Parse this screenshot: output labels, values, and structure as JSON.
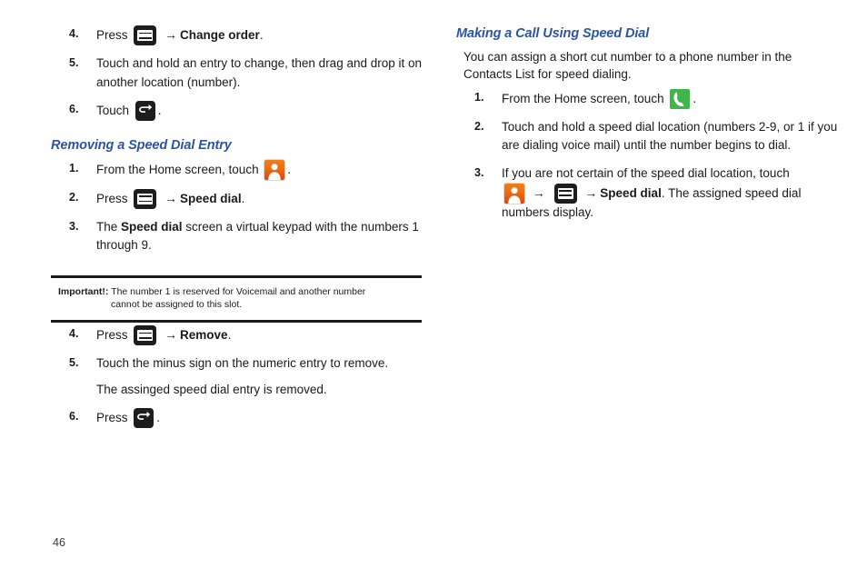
{
  "page": {
    "number": "46"
  },
  "icons": {
    "menu": "menu-key-icon",
    "back": "back-key-icon",
    "contacts": "contacts-app-icon",
    "phone": "phone-app-icon",
    "arrow": "→"
  },
  "left_column": {
    "continued_steps": [
      {
        "num": "4.",
        "parts": [
          "Press ",
          "[menu-icon]",
          " → ",
          "Change order",
          "."
        ],
        "lead": "Press",
        "icon": "menu",
        "bold_text": "Change order",
        "trailing": "."
      },
      {
        "num": "5.",
        "text": "Touch and hold an entry to change, then drag and drop it on another location (number)."
      },
      {
        "num": "6.",
        "lead": "Touch",
        "icon": "back",
        "trailing": "."
      }
    ],
    "section": {
      "heading": "Removing a Speed Dial Entry",
      "steps": [
        {
          "num": "1.",
          "lead": "From the Home screen, touch",
          "icon": "contacts",
          "trailing": "."
        },
        {
          "num": "2.",
          "lead": "Press",
          "icon": "menu",
          "bold_text": "Speed dial",
          "trailing": "."
        },
        {
          "num": "3.",
          "pre": "The ",
          "bold_text": "Speed dial",
          "post": " screen a virtual keypad with the numbers 1 through 9."
        }
      ]
    },
    "note": {
      "label": "Important!:",
      "line1": "The number 1 is reserved for Voicemail and another number",
      "line2": "cannot be assigned to this slot."
    },
    "lower_steps": [
      {
        "num": "4.",
        "lead": "Press",
        "icon": "menu",
        "bold_text": "Remove",
        "trailing": "."
      },
      {
        "num": "5.",
        "text": "Touch the minus sign on the numeric entry to remove.",
        "sub": "The assinged speed dial entry is removed."
      },
      {
        "num": "6.",
        "lead": "Press",
        "icon": "back",
        "trailing": "."
      }
    ]
  },
  "right_column": {
    "heading": "Making a Call Using Speed Dial",
    "intro": "You can assign a short cut number to a phone number in the Contacts List for speed dialing.",
    "steps": [
      {
        "num": "1.",
        "lead": "From the Home screen, touch",
        "icon": "phone",
        "trailing": "."
      },
      {
        "num": "2.",
        "text": "Touch and hold a speed dial location (numbers 2-9, or 1 if you are dialing voice mail) until the number begins to dial."
      },
      {
        "num": "3.",
        "pre": "If you are not certain of the speed dial location, touch",
        "bold_text": "Speed dial",
        "post": ". The assigned speed dial numbers display."
      }
    ]
  },
  "colors": {
    "heading_blue": "#2b53a8",
    "body_text": "#1a1a1a",
    "icon_dark": "#1d1d1d",
    "icon_orange": "#ee6b12",
    "icon_green": "#3fb54a"
  }
}
